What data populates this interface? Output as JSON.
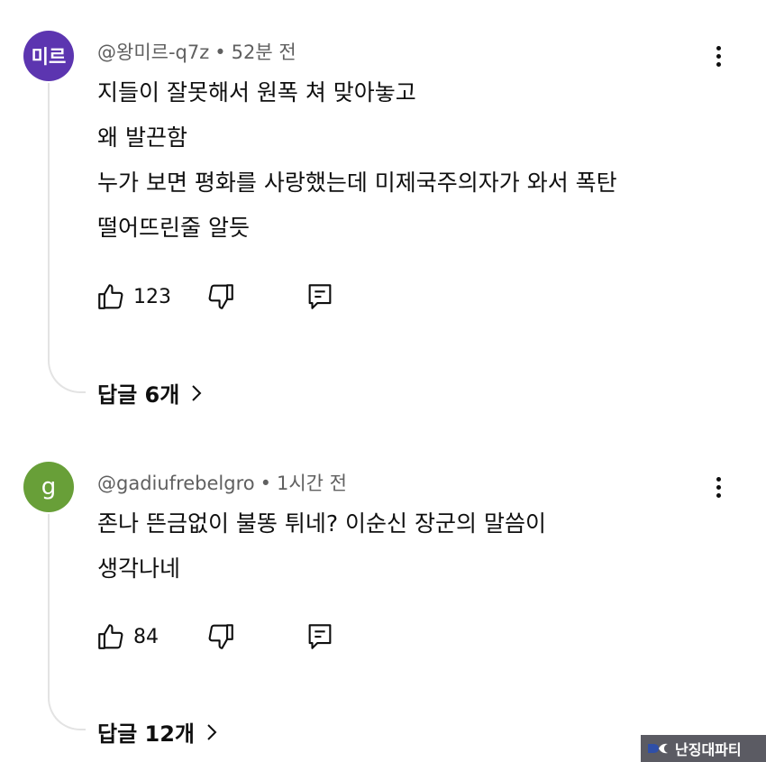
{
  "comments": [
    {
      "avatar_letter": "미르",
      "avatar_color": "#5c35b0",
      "author": "@왕미르-q7z",
      "time": "52분 전",
      "lines": [
        "지들이 잘못해서 원폭 쳐 맞아놓고",
        "왜 발끈함",
        "누가 보면 평화를 사랑했는데 미제국주의자가 와서 폭탄",
        "떨어뜨린줄 알듯"
      ],
      "likes": "123",
      "replies_label": "답글 6개"
    },
    {
      "avatar_letter": "g",
      "avatar_color": "#689f38",
      "author": "@gadiufrebelgro",
      "time": "1시간 전",
      "lines": [
        "존나 뜬금없이 불똥 튀네? 이순신 장군의 말씀이",
        "생각나네"
      ],
      "likes": "84",
      "replies_label": "답글 12개"
    }
  ],
  "icons": {
    "like": "thumbs-up-icon",
    "dislike": "thumbs-down-icon",
    "reply": "reply-icon",
    "more": "more-vert-icon",
    "chevron": "chevron-right-icon"
  },
  "watermark": "난징대파티"
}
